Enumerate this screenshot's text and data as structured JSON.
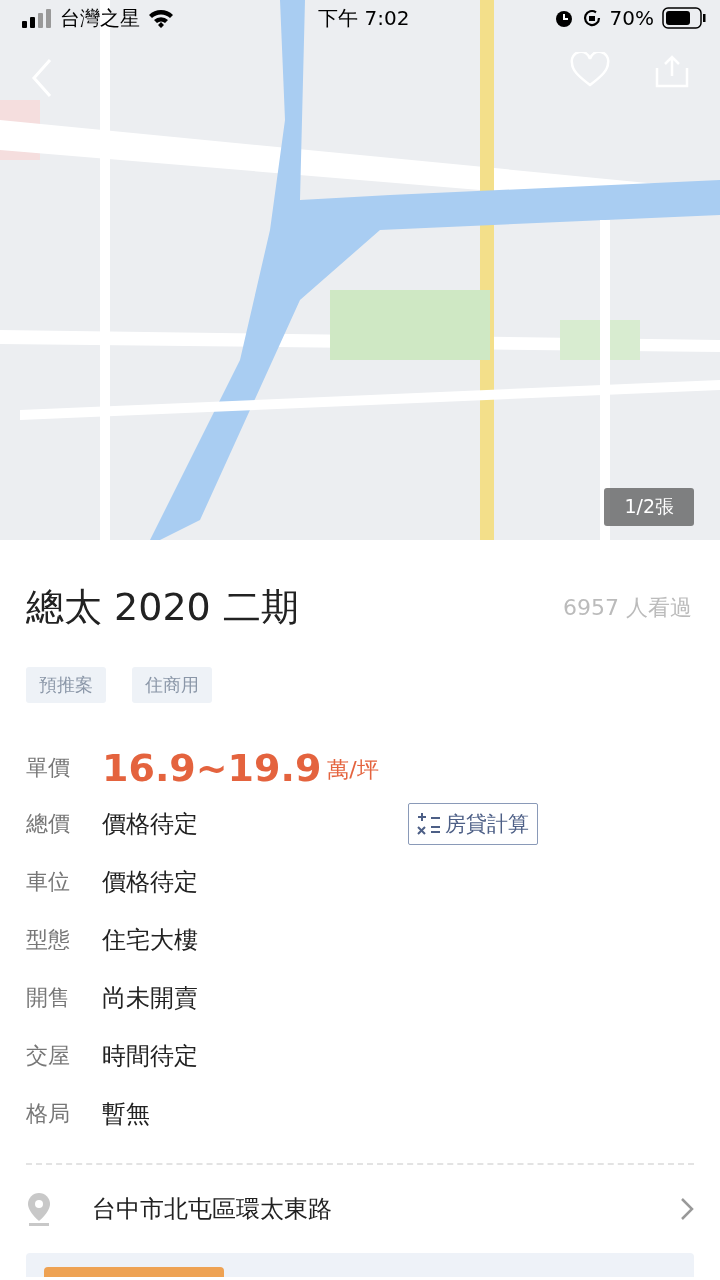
{
  "status_bar": {
    "carrier": "台灣之星",
    "time": "下午 7:02",
    "battery": "70%"
  },
  "photo": {
    "counter": "1/2張"
  },
  "title": "總太 2020 二期",
  "views": "6957 人看過",
  "tags": [
    "預推案",
    "住商用"
  ],
  "price": {
    "label": "單價",
    "value": "16.9~19.9",
    "unit": "萬/坪"
  },
  "details": [
    {
      "label": "總價",
      "value": "價格待定",
      "action": "房貸計算"
    },
    {
      "label": "車位",
      "value": "價格待定"
    },
    {
      "label": "型態",
      "value": "住宅大樓"
    },
    {
      "label": "開售",
      "value": "尚未開賣"
    },
    {
      "label": "交屋",
      "value": "時間待定"
    },
    {
      "label": "格局",
      "value": "暫無"
    }
  ],
  "address": "台中市北屯區環太東路"
}
